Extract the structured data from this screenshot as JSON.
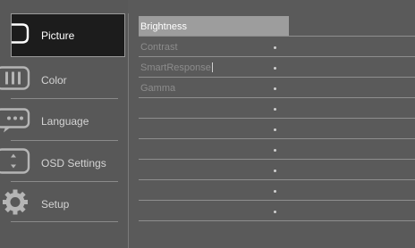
{
  "sidebar": {
    "items": [
      {
        "label": "Picture",
        "icon": "picture-icon",
        "selected": true
      },
      {
        "label": "Color",
        "icon": "color-icon",
        "selected": false
      },
      {
        "label": "Language",
        "icon": "language-icon",
        "selected": false
      },
      {
        "label": "OSD Settings",
        "icon": "osd-settings-icon",
        "selected": false
      },
      {
        "label": "Setup",
        "icon": "gear-icon",
        "selected": false
      }
    ]
  },
  "submenu": {
    "items": [
      {
        "label": "Brightness",
        "highlighted": true
      },
      {
        "label": "Contrast"
      },
      {
        "label": "SmartResponse"
      },
      {
        "label": "Gamma"
      },
      {
        "label": ""
      },
      {
        "label": ""
      },
      {
        "label": ""
      },
      {
        "label": ""
      },
      {
        "label": ""
      },
      {
        "label": ""
      }
    ]
  },
  "colors": {
    "background": "#5a5a5a",
    "selected_item_bg": "#1c1c1c",
    "highlight_row_bg": "#9d9d9d",
    "text_active": "#ffffff",
    "text_inactive": "#8c8c8c"
  }
}
